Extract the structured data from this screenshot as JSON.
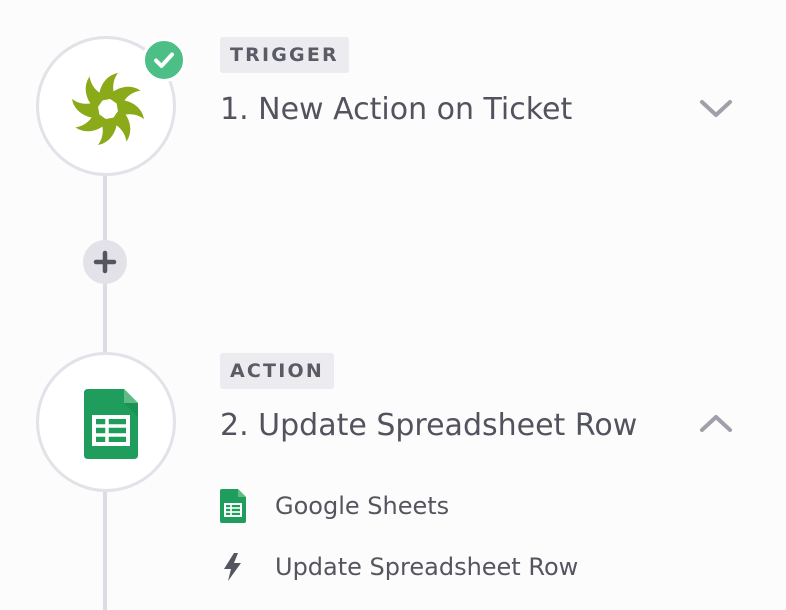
{
  "steps": [
    {
      "badge": "TRIGGER",
      "title": "1. New Action on Ticket",
      "icon": "teamwork-desk-flower-icon",
      "status": "complete",
      "expanded": false
    },
    {
      "badge": "ACTION",
      "title": "2. Update Spreadsheet Row",
      "icon": "google-sheets-icon",
      "expanded": true,
      "details": [
        {
          "icon": "google-sheets-icon",
          "label": "Google Sheets"
        },
        {
          "icon": "lightning-bolt-icon",
          "label": "Update Spreadsheet Row"
        }
      ]
    }
  ],
  "add_step_icon": "plus-icon",
  "colors": {
    "check_green": "#4cbf86",
    "flower_green": "#8aaa1a",
    "sheets_green": "#1e9d5c",
    "connector": "#dcdce3",
    "badge_bg": "#ececf0"
  }
}
